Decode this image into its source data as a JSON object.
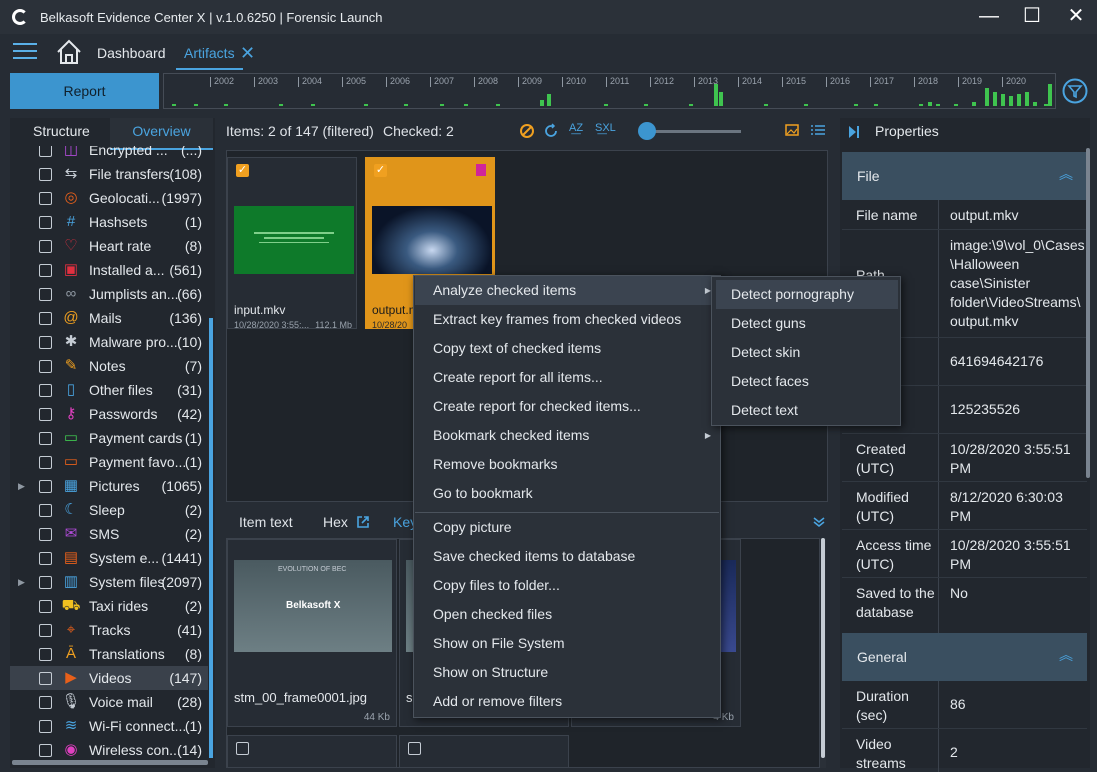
{
  "window": {
    "title": "Belkasoft Evidence Center X | v.1.0.6250 | Forensic Launch",
    "minimize": "—",
    "maximize": "☐",
    "close": "✕"
  },
  "nav": {
    "dashboard": "Dashboard",
    "artifacts": "Artifacts",
    "close_tab": "✕"
  },
  "toolbar": {
    "report": "Report"
  },
  "timeline": {
    "years": [
      "2002",
      "2003",
      "2004",
      "2005",
      "2006",
      "2007",
      "2008",
      "2009",
      "2010",
      "2011",
      "2012",
      "2013",
      "2014",
      "2015",
      "2016",
      "2017",
      "2018",
      "2019",
      "2020"
    ]
  },
  "left": {
    "tab_structure": "Structure",
    "tab_overview": "Overview",
    "items": [
      {
        "label": "Encrypted ...",
        "count": "(...)",
        "icon": "◫",
        "color": "#b04bd8",
        "expand": ""
      },
      {
        "label": "File transfers",
        "count": "(108)",
        "icon": "⇆",
        "color": "#c5ccd4",
        "expand": ""
      },
      {
        "label": "Geolocati...",
        "count": "(1997)",
        "icon": "◎",
        "color": "#e8601a",
        "expand": ""
      },
      {
        "label": "Hashsets",
        "count": "(1)",
        "icon": "#",
        "color": "#4aa4e0",
        "expand": ""
      },
      {
        "label": "Heart rate",
        "count": "(8)",
        "icon": "♡",
        "color": "#e03040",
        "expand": ""
      },
      {
        "label": "Installed a...",
        "count": "(561)",
        "icon": "▣",
        "color": "#e03040",
        "expand": ""
      },
      {
        "label": "Jumplists an...",
        "count": "(66)",
        "icon": "∞",
        "color": "#8f98a2",
        "expand": ""
      },
      {
        "label": "Mails",
        "count": "(136)",
        "icon": "@",
        "color": "#f0a020",
        "expand": ""
      },
      {
        "label": "Malware pro...",
        "count": "(10)",
        "icon": "✱",
        "color": "#c5ccd4",
        "expand": ""
      },
      {
        "label": "Notes",
        "count": "(7)",
        "icon": "✎",
        "color": "#f0a020",
        "expand": ""
      },
      {
        "label": "Other files",
        "count": "(31)",
        "icon": "▯",
        "color": "#4aa4e0",
        "expand": ""
      },
      {
        "label": "Passwords",
        "count": "(42)",
        "icon": "⚷",
        "color": "#e040c0",
        "expand": ""
      },
      {
        "label": "Payment cards",
        "count": "(1)",
        "icon": "▭",
        "color": "#3fc44f",
        "expand": ""
      },
      {
        "label": "Payment favo...",
        "count": "(1)",
        "icon": "▭",
        "color": "#e8601a",
        "expand": ""
      },
      {
        "label": "Pictures",
        "count": "(1065)",
        "icon": "▦",
        "color": "#4aa4e0",
        "expand": "▶"
      },
      {
        "label": "Sleep",
        "count": "(2)",
        "icon": "☾",
        "color": "#4aa4e0",
        "expand": ""
      },
      {
        "label": "SMS",
        "count": "(2)",
        "icon": "✉",
        "color": "#b04bd8",
        "expand": ""
      },
      {
        "label": "System e...",
        "count": "(1441)",
        "icon": "▤",
        "color": "#e8601a",
        "expand": ""
      },
      {
        "label": "System files",
        "count": "(2097)",
        "icon": "▥",
        "color": "#4aa4e0",
        "expand": "▶"
      },
      {
        "label": "Taxi rides",
        "count": "(2)",
        "icon": "⛟",
        "color": "#f0c020",
        "expand": ""
      },
      {
        "label": "Tracks",
        "count": "(41)",
        "icon": "⌖",
        "color": "#e8601a",
        "expand": ""
      },
      {
        "label": "Translations",
        "count": "(8)",
        "icon": "Ā",
        "color": "#f0a020",
        "expand": ""
      },
      {
        "label": "Videos",
        "count": "(147)",
        "icon": "▶",
        "color": "#e8601a",
        "expand": "",
        "selected": true
      },
      {
        "label": "Voice mail",
        "count": "(28)",
        "icon": "🎙",
        "color": "#c5ccd4",
        "expand": ""
      },
      {
        "label": "Wi-Fi connect...",
        "count": "(1)",
        "icon": "≋",
        "color": "#4aa4e0",
        "expand": ""
      },
      {
        "label": "Wireless con...",
        "count": "(14)",
        "icon": "◉",
        "color": "#e040c0",
        "expand": ""
      }
    ]
  },
  "center": {
    "items_info": "Items: 2 of 147 (filtered)",
    "checked_info": "Checked: 2",
    "thumbs": [
      {
        "name": "input.mkv",
        "date": "10/28/2020 3:55:...",
        "size": "112.1 Mb",
        "checked": "✓"
      },
      {
        "name": "output.m",
        "date": "10/28/20",
        "size": "",
        "checked": "✓"
      }
    ],
    "tabs": {
      "item_text": "Item text",
      "hex": "Hex",
      "key": "Key"
    },
    "frames": [
      {
        "name": "stm_00_frame0001.jpg",
        "size": "44 Kb",
        "img_text": "EVOLUTION OF BEC",
        "logo": "Belkasoft X"
      },
      {
        "name": "s",
        "size": "",
        "img_text": "",
        "logo": ""
      },
      {
        "name": "",
        "size": "4 Kb",
        "img_text": "",
        "logo": ""
      }
    ]
  },
  "context_menu": {
    "items": [
      {
        "label": "Analyze checked items",
        "submenu": true,
        "highlight": true
      },
      {
        "label": "Extract key frames from checked videos"
      },
      {
        "label": "Copy text of checked items"
      },
      {
        "label": "Create report for all items..."
      },
      {
        "label": "Create report for checked items..."
      },
      {
        "label": "Bookmark checked items",
        "submenu": true
      },
      {
        "label": "Remove bookmarks"
      },
      {
        "label": "Go to bookmark"
      },
      {
        "label": "Copy picture"
      },
      {
        "label": "Save checked items to database"
      },
      {
        "label": "Copy files to folder..."
      },
      {
        "label": "Open checked files"
      },
      {
        "label": "Show on File System"
      },
      {
        "label": "Show on Structure"
      },
      {
        "label": "Add or remove filters"
      }
    ],
    "submenu": [
      "Detect pornography",
      "Detect guns",
      "Detect skin",
      "Detect faces",
      "Detect text"
    ]
  },
  "properties": {
    "title": "Properties",
    "file_group": "File",
    "general_group": "General",
    "rows": [
      {
        "key": "File name",
        "value": "output.mkv"
      },
      {
        "key": "Path",
        "value": "image:\\9\\vol_0\\Cases\\Halloween case\\Sinister folder\\VideoStreams\\output.mkv"
      },
      {
        "key": "",
        "value": "641694642176"
      },
      {
        "key": "",
        "value": "125235526"
      },
      {
        "key": "Created (UTC)",
        "value": "10/28/2020 3:55:51 PM"
      },
      {
        "key": "Modified (UTC)",
        "value": "8/12/2020 6:30:03 PM"
      },
      {
        "key": "Access time (UTC)",
        "value": "10/28/2020 3:55:51 PM"
      },
      {
        "key": "Saved to the database",
        "value": "No"
      }
    ],
    "general_rows": [
      {
        "key": "Duration (sec)",
        "value": "86"
      },
      {
        "key": "Video streams",
        "value": "2"
      }
    ]
  }
}
